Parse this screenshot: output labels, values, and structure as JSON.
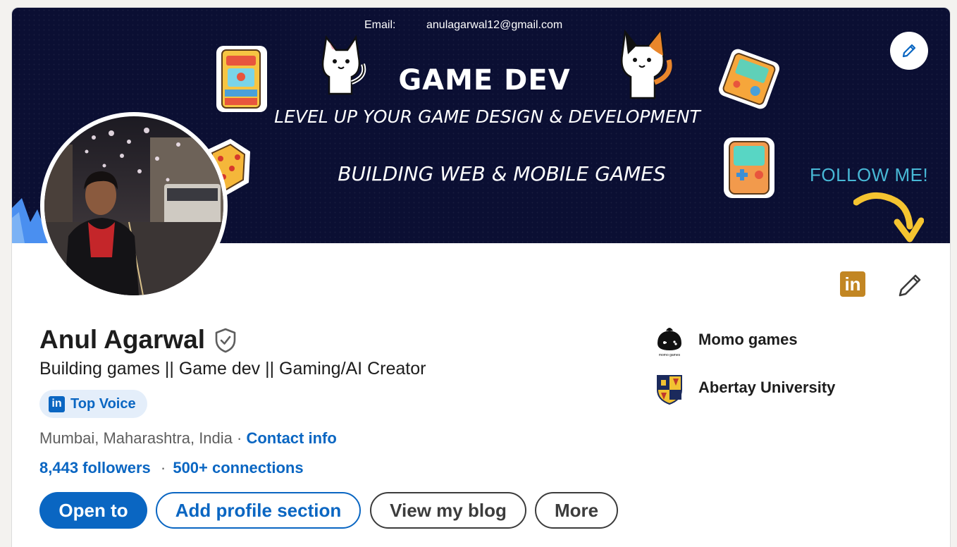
{
  "banner": {
    "email_label": "Email:",
    "email_value": "anulagarwal12@gmail.com",
    "title": "GAME DEV",
    "subtitle": "LEVEL UP YOUR GAME DESIGN & DEVELOPMENT",
    "tagline": "BUILDING WEB & MOBILE GAMES",
    "follow": "FOLLOW ME!",
    "bg_color": "#0b0f33"
  },
  "profile": {
    "name": "Anul Agarwal",
    "headline": "Building games || Game dev || Gaming/AI Creator",
    "badge_label": "Top Voice",
    "badge_icon": "in",
    "location": "Mumbai, Maharashtra, India",
    "separator": "·",
    "contact_info": "Contact info",
    "followers": "8,443 followers",
    "connections": "500+ connections"
  },
  "actions": {
    "open_to": "Open to",
    "add_section": "Add profile section",
    "view_blog": "View my blog",
    "more": "More"
  },
  "side": {
    "linkedin_icon": "in",
    "orgs": [
      {
        "name": "Momo games",
        "logo_text": "momo games"
      },
      {
        "name": "Abertay University"
      }
    ]
  },
  "colors": {
    "accent": "#0a66c2",
    "brand_badge": "#c28623",
    "follow": "#48b8d6"
  }
}
